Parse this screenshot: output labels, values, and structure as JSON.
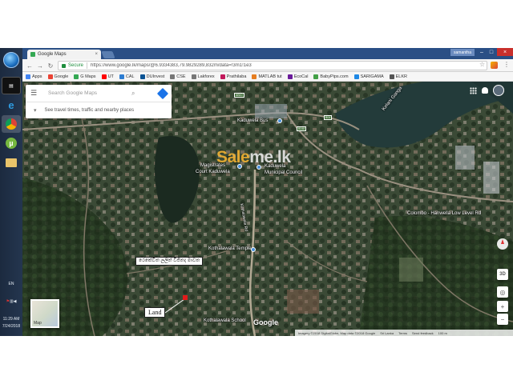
{
  "browser": {
    "tab_title": "Google Maps",
    "profile_label": "samantha",
    "secure_label": "Secure",
    "url": "https://www.google.lk/maps/@6.9334383,79.9829289,832m/data=!3m1!1e3"
  },
  "bookmarks": [
    {
      "label": "Apps",
      "color": "#4285f4"
    },
    {
      "label": "Google",
      "color": "#ea4335"
    },
    {
      "label": "G Maps",
      "color": "#34a853"
    },
    {
      "label": "UT",
      "color": "#ff0000"
    },
    {
      "label": "CAL",
      "color": "#2d7dd2"
    },
    {
      "label": "DUInvest",
      "color": "#0b5394"
    },
    {
      "label": "CSE",
      "color": "#777777"
    },
    {
      "label": "Lakforex",
      "color": "#777777"
    },
    {
      "label": "Prathilaba",
      "color": "#c2185b"
    },
    {
      "label": "MATLAB tut",
      "color": "#e67e22"
    },
    {
      "label": "EcoCal",
      "color": "#6a1b9a"
    },
    {
      "label": "BabyPips.com",
      "color": "#43a047"
    },
    {
      "label": "SARIGAMA",
      "color": "#1e88e5"
    },
    {
      "label": "ELKR",
      "color": "#555555"
    }
  ],
  "search": {
    "placeholder": "Search Google Maps",
    "hint": "See travel times, traffic and nearby places"
  },
  "map": {
    "labels": {
      "bus": "Kaduwela Bus",
      "magistrates_1": "Magistrates",
      "magistrates_2": "Court Kaduwela",
      "council_1": "Kaduwela",
      "council_2": "Municipal Council",
      "river": "Kelani Ganga",
      "road": "Colombo - Hanwella Low Level Rd",
      "temple": "Kothalawala Temple",
      "school": "Kothalawala School",
      "lane": "Kothalawala Rd"
    },
    "road_signs": {
      "a": "AB10",
      "b": "B048",
      "c": "B04"
    },
    "watermark_a": "Sale",
    "watermark_b": "me.lk",
    "annotation_sinhala": "රෙකේවිත ලලිත් විජිතද මාවත",
    "annotation_land": "Land",
    "google": "Google",
    "layer_thumb": "Map",
    "footer": [
      "Imagery ©2018 DigitalGlobe, Map data ©2018 Google",
      "Sri Lanka",
      "Terms",
      "Send feedback",
      "100 m"
    ],
    "controls": {
      "tilt": "3D",
      "zoom_in": "+",
      "zoom_out": "−"
    }
  },
  "taskbar": {
    "lang": "EN",
    "time": "11:29 AM",
    "date": "7/24/2018"
  }
}
